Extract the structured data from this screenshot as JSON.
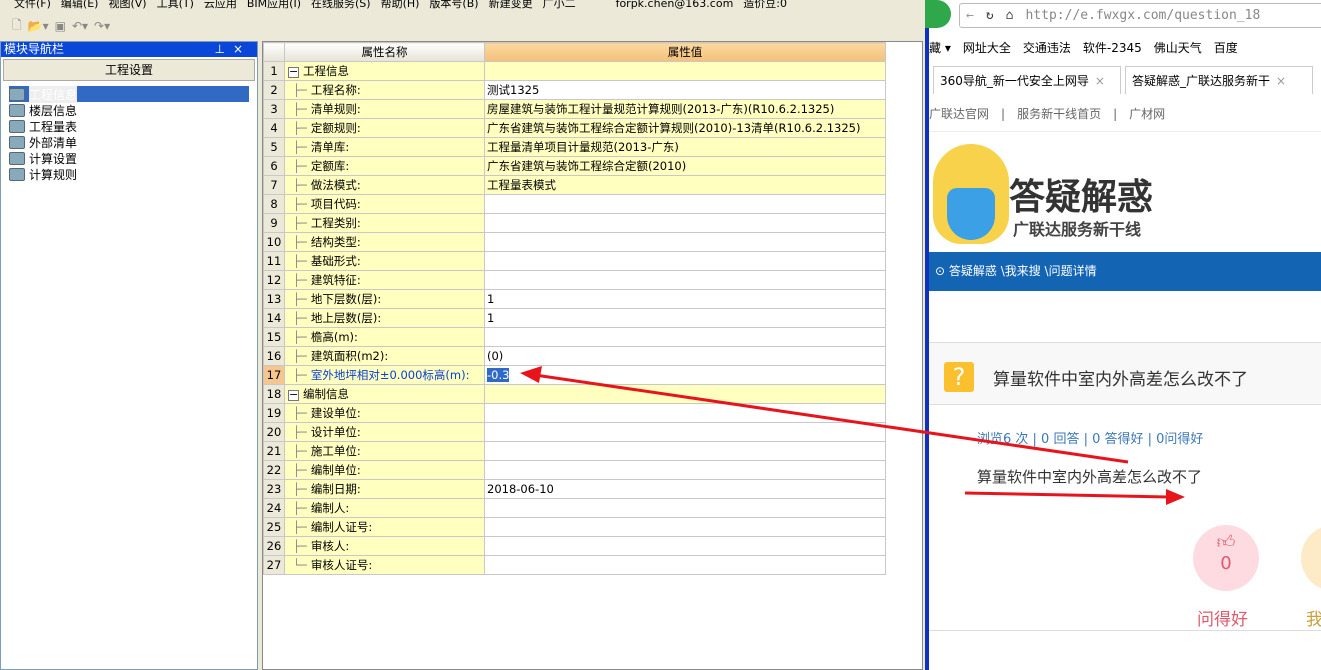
{
  "menu": [
    "文件(F)",
    "编辑(E)",
    "视图(V)",
    "工具(T)",
    "云应用",
    "BIM应用(I)",
    "在线服务(S)",
    "帮助(H)",
    "版本号(B)",
    "新建变更",
    "广小二"
  ],
  "account": {
    "email": "forpk.chen@163.com",
    "beans": "造价豆:0"
  },
  "nav": {
    "title": "模块导航栏",
    "pin": "ᵖ",
    "close": "×",
    "section": "工程设置",
    "items": [
      "工程信息",
      "楼层信息",
      "工程量表",
      "外部清单",
      "计算设置",
      "计算规则"
    ]
  },
  "grid": {
    "headers": [
      "属性名称",
      "属性值"
    ],
    "rows": [
      {
        "n": "1",
        "name": "工程信息",
        "value": "",
        "group": true
      },
      {
        "n": "2",
        "name": "工程名称:",
        "value": "测试1325"
      },
      {
        "n": "3",
        "name": "清单规则:",
        "value": "房屋建筑与装饰工程计量规范计算规则(2013-广东)(R10.6.2.1325)",
        "y": true
      },
      {
        "n": "4",
        "name": "定额规则:",
        "value": "广东省建筑与装饰工程综合定额计算规则(2010)-13清单(R10.6.2.1325)",
        "y": true
      },
      {
        "n": "5",
        "name": "清单库:",
        "value": "工程量清单项目计量规范(2013-广东)",
        "y": true
      },
      {
        "n": "6",
        "name": "定额库:",
        "value": "广东省建筑与装饰工程综合定额(2010)",
        "y": true
      },
      {
        "n": "7",
        "name": "做法模式:",
        "value": "工程量表模式",
        "y": true
      },
      {
        "n": "8",
        "name": "项目代码:",
        "value": ""
      },
      {
        "n": "9",
        "name": "工程类别:",
        "value": ""
      },
      {
        "n": "10",
        "name": "结构类型:",
        "value": ""
      },
      {
        "n": "11",
        "name": "基础形式:",
        "value": ""
      },
      {
        "n": "12",
        "name": "建筑特征:",
        "value": ""
      },
      {
        "n": "13",
        "name": "地下层数(层):",
        "value": "1"
      },
      {
        "n": "14",
        "name": "地上层数(层):",
        "value": "1"
      },
      {
        "n": "15",
        "name": "檐高(m):",
        "value": ""
      },
      {
        "n": "16",
        "name": "建筑面积(m2):",
        "value": "(0)"
      },
      {
        "n": "17",
        "name": "室外地坪相对±0.000标高(m):",
        "value": "-0.3",
        "current": true
      },
      {
        "n": "18",
        "name": "编制信息",
        "value": "",
        "group": true
      },
      {
        "n": "19",
        "name": "建设单位:",
        "value": ""
      },
      {
        "n": "20",
        "name": "设计单位:",
        "value": ""
      },
      {
        "n": "21",
        "name": "施工单位:",
        "value": ""
      },
      {
        "n": "22",
        "name": "编制单位:",
        "value": ""
      },
      {
        "n": "23",
        "name": "编制日期:",
        "value": "2018-06-10"
      },
      {
        "n": "24",
        "name": "编制人:",
        "value": ""
      },
      {
        "n": "25",
        "name": "编制人证号:",
        "value": ""
      },
      {
        "n": "26",
        "name": "审核人:",
        "value": ""
      },
      {
        "n": "27",
        "name": "审核人证号:",
        "value": ""
      }
    ]
  },
  "browser": {
    "url": "http://e.fwxgx.com/question_18",
    "bookmarks": [
      "藏 ▾",
      "网址大全",
      "交通违法",
      "软件-2345",
      "佛山天气",
      "百度"
    ],
    "tabs": [
      "360导航_新一代安全上网导",
      "答疑解惑_广联达服务新干"
    ],
    "subnav": [
      "广联达官网",
      "|",
      "服务新干线首页",
      "|",
      "广材网"
    ],
    "logo_title": "答疑解惑",
    "logo_sub": "广联达服务新干线",
    "breadcrumb": "答疑解惑 \\我来搜 \\问题详情",
    "question_title": "算量软件中室内外高差怎么改不了",
    "stats": "浏览6 次 | 0 回答 | 0 答得好 | 0问得好",
    "question_text": "算量软件中室内外高差怎么改不了",
    "like_count": "0",
    "like_label": "问得好",
    "other_label": "我"
  },
  "colors": {
    "accent": "#1464b4",
    "annotation": "#e8141c",
    "title_bar": "#0a46d8"
  }
}
